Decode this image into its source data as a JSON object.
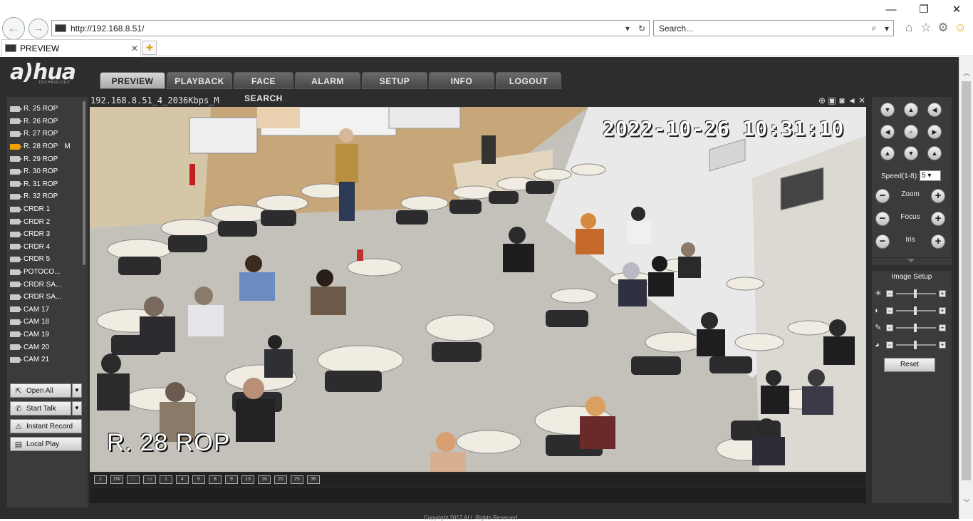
{
  "browser": {
    "address": "http://192.168.8.51/",
    "search_placeholder": "Search...",
    "tab_title": "PREVIEW",
    "window_controls": [
      "minimize-icon",
      "restore-icon",
      "close-icon"
    ]
  },
  "app": {
    "logo": "a)hua",
    "logo_sub": "TECHNOLOGY",
    "menu": [
      {
        "label": "PREVIEW",
        "active": true
      },
      {
        "label": "PLAYBACK",
        "active": false
      },
      {
        "label": "FACE SEARCH",
        "active": false
      },
      {
        "label": "ALARM",
        "active": false
      },
      {
        "label": "SETUP",
        "active": false
      },
      {
        "label": "INFO",
        "active": false
      },
      {
        "label": "LOGOUT",
        "active": false
      }
    ],
    "channels": [
      {
        "name": "R. 25 ROP",
        "active": false,
        "flag": ""
      },
      {
        "name": "R. 26 ROP",
        "active": false,
        "flag": ""
      },
      {
        "name": "R. 27 ROP",
        "active": false,
        "flag": ""
      },
      {
        "name": "R. 28 ROP",
        "active": true,
        "flag": "M"
      },
      {
        "name": "R. 29 ROP",
        "active": false,
        "flag": ""
      },
      {
        "name": "R. 30 ROP",
        "active": false,
        "flag": ""
      },
      {
        "name": "R. 31 ROP",
        "active": false,
        "flag": ""
      },
      {
        "name": "R. 32 ROP",
        "active": false,
        "flag": ""
      },
      {
        "name": "CRDR 1",
        "active": false,
        "flag": ""
      },
      {
        "name": "CRDR 2",
        "active": false,
        "flag": ""
      },
      {
        "name": "CRDR 3",
        "active": false,
        "flag": ""
      },
      {
        "name": "CRDR 4",
        "active": false,
        "flag": ""
      },
      {
        "name": "CRDR 5",
        "active": false,
        "flag": ""
      },
      {
        "name": "POTOCO...",
        "active": false,
        "flag": ""
      },
      {
        "name": "CRDR SA...",
        "active": false,
        "flag": ""
      },
      {
        "name": "CRDR SA...",
        "active": false,
        "flag": ""
      },
      {
        "name": "CAM 17",
        "active": false,
        "flag": ""
      },
      {
        "name": "CAM 18",
        "active": false,
        "flag": ""
      },
      {
        "name": "CAM 19",
        "active": false,
        "flag": ""
      },
      {
        "name": "CAM 20",
        "active": false,
        "flag": ""
      },
      {
        "name": "CAM 21",
        "active": false,
        "flag": ""
      }
    ],
    "actions": {
      "open_all": "Open All",
      "start_talk": "Start Talk",
      "instant_record": "Instant Record",
      "local_play": "Local Play"
    },
    "stream_label": "192.168.8.51_4_2036Kbps_M",
    "video": {
      "timestamp": "2022-10-26 10:31:10",
      "camera_name": "R. 28 ROP"
    },
    "layouts": [
      "1",
      "1W",
      "⛶",
      "▭",
      "1",
      "4",
      "6",
      "8",
      "9",
      "13",
      "16",
      "20",
      "25",
      "36"
    ],
    "ptz": {
      "speed_label": "Speed(1-8):",
      "speed_value": "5",
      "zoom_label": "Zoom",
      "focus_label": "Focus",
      "iris_label": "Iris"
    },
    "image_setup": {
      "title": "Image Setup",
      "reset": "Reset",
      "rows": [
        {
          "icon": "brightness-icon",
          "level": 0.45
        },
        {
          "icon": "contrast-icon",
          "level": 0.45
        },
        {
          "icon": "saturation-icon",
          "level": 0.45
        },
        {
          "icon": "hue-icon",
          "level": 0.45
        }
      ]
    },
    "copyright": "Copyright 2017 ALL Rights Reserved"
  }
}
